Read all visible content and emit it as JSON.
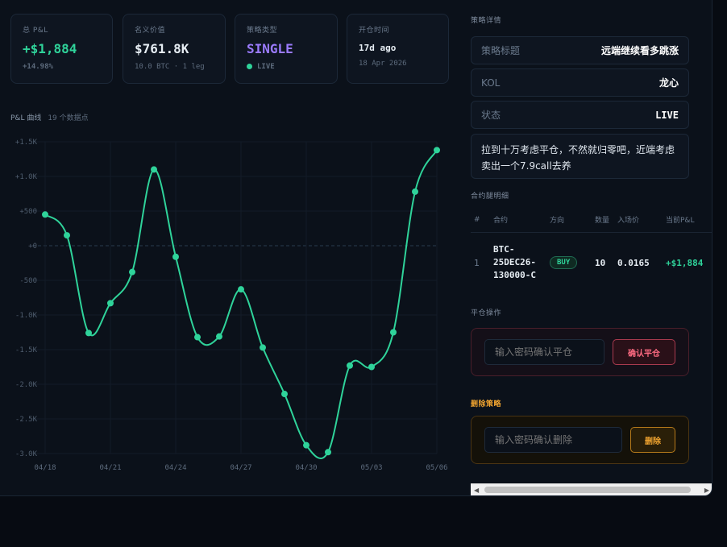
{
  "stats": [
    {
      "label": "总 P&L",
      "value": "+$1,884",
      "sub": "+14.98%"
    },
    {
      "label": "名义价值",
      "value": "$761.8K",
      "sub": "10.0 BTC · 1 leg"
    },
    {
      "label": "策略类型",
      "value": "SINGLE",
      "sub": "LIVE"
    },
    {
      "label": "开仓时间",
      "value": "17d ago",
      "sub": "18 Apr 2026"
    }
  ],
  "chart_section": {
    "title": "P&L 曲线",
    "count": "19 个数据点"
  },
  "chart_data": {
    "type": "line",
    "series": [
      {
        "values": [
          450,
          150,
          -1260,
          -830,
          -380,
          1100,
          -160,
          -1320,
          -1310,
          -630,
          -1470,
          -2140,
          -2880,
          -2980,
          -1730,
          -1750,
          -1250,
          780,
          1380
        ]
      }
    ],
    "x_ticks": [
      "04/18",
      "04/21",
      "04/24",
      "04/27",
      "04/30",
      "05/03",
      "05/06"
    ],
    "y_ticks": [
      "+1.5K",
      "+1.0K",
      "+500",
      "+0",
      "-500",
      "-1.0K",
      "-1.5K",
      "-2.0K",
      "-2.5K",
      "-3.0K"
    ],
    "ylim": [
      -3000,
      1500
    ],
    "line_color": "#2fd39a",
    "grid": true
  },
  "details": {
    "section_label": "策略详情",
    "rows": [
      {
        "key": "策略标题",
        "value": "远端继续看多跳涨"
      },
      {
        "key": "KOL",
        "value": "龙心"
      },
      {
        "key": "状态",
        "value": "LIVE"
      }
    ],
    "note": "拉到十万考虑平仓，不然就归零吧，近端考虑卖出一个7.9call去养"
  },
  "legs": {
    "section_label": "合约腿明细",
    "headers": [
      "#",
      "合约",
      "方向",
      "数量",
      "入场价",
      "当前P&L"
    ],
    "rows": [
      {
        "idx": "1",
        "contract_l1": "BTC-",
        "contract_l2": "25DEC26-",
        "contract_l3": "130000-C",
        "side": "BUY",
        "qty": "10",
        "entry": "0.0165",
        "pnl": "+$1,884"
      }
    ]
  },
  "close_action": {
    "section_label": "平仓操作",
    "placeholder": "输入密码确认平仓",
    "button": "确认平仓"
  },
  "delete_action": {
    "section_label": "删除策略",
    "placeholder": "输入密码确认删除",
    "button": "删除"
  },
  "colors": {
    "accent_green": "#2fd39a",
    "purple": "#9b7bff",
    "danger": "#ff6b82",
    "warning": "#f0a430"
  }
}
